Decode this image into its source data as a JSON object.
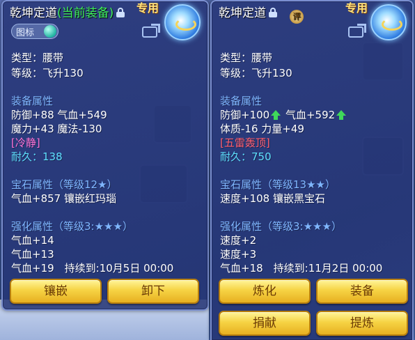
{
  "left": {
    "title": "乾坤定道",
    "title_status": "(当前装备)",
    "exclusive": "专用",
    "badge_label": "图标",
    "type_line": "类型：腰带",
    "level_line": "等级：飞升130",
    "equip_attr_header": "装备属性",
    "attr_line1": "防御+88 气血+549",
    "attr_line2": "魔力+43 魔法-130",
    "special": "[冷静]",
    "durability_label": "耐久：",
    "durability_value": "138",
    "gem_header": "宝石属性（等级12★）",
    "gem_line": "气血+857 镶嵌红玛瑙",
    "enhance_header": "强化属性（等级3:★★★）",
    "enhance_line1": "气血+14",
    "enhance_line2": "气血+13",
    "enhance_line3": "气血+19　持续到:10月5日 00:00",
    "buttons": [
      "镶嵌",
      "卸下"
    ]
  },
  "right": {
    "title": "乾坤定道",
    "rating_icon_text": "评",
    "exclusive": "专用",
    "type_line": "类型：腰带",
    "level_line": "等级：飞升130",
    "equip_attr_header": "装备属性",
    "attr_def": "防御+100",
    "attr_hp": "气血+592",
    "attr_line2": "体质-16 力量+49",
    "special": "[五雷轰顶]",
    "durability_label": "耐久：",
    "durability_value": "750",
    "gem_header": "宝石属性（等级13★★）",
    "gem_line": "速度+108 镶嵌黑宝石",
    "enhance_header": "强化属性（等级3:★★★）",
    "enhance_line1": "速度+2",
    "enhance_line2": "速度+3",
    "enhance_line3": "气血+18　持续到:11月2日 00:00",
    "buttons": [
      "炼化",
      "装备",
      "捐献",
      "提炼"
    ]
  },
  "colors": {
    "current_equip": "#3ef05a",
    "section_header": "#7fb6ff",
    "special_left": "#ff73d6",
    "special_right": "#ff5f6f",
    "durability": "#5fe0ff",
    "button_gold": "#f6d344"
  },
  "icons": [
    "lock-icon",
    "rating-icon",
    "share-icon",
    "item-icon",
    "gem-icon",
    "up-arrow-icon"
  ]
}
